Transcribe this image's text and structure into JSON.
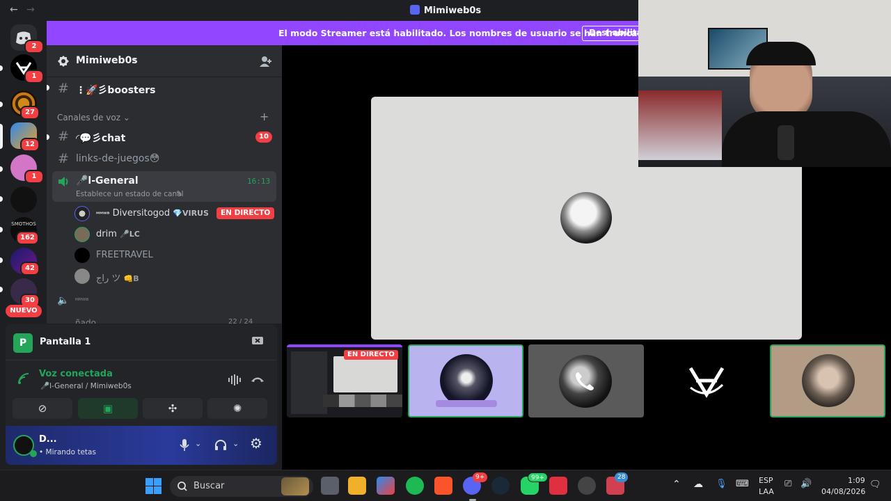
{
  "titlebar": {
    "title": "Mimiweb0s",
    "back_icon": "←",
    "forward_icon": "→"
  },
  "banner": {
    "message": "El modo Streamer está habilitado. Los nombres de usuario se han truncado.",
    "button": "Deshabilitar"
  },
  "guild_rail": {
    "home_badge": "2",
    "badges": [
      "1",
      "27",
      "12",
      "1",
      "162",
      "42",
      "30"
    ],
    "new_label": "NUEVO",
    "server_tile_text": "SMOTHOS"
  },
  "server": {
    "name": "Mimiweb0s",
    "chevron": "⌄"
  },
  "channels": {
    "boosters": "⋮🚀彡boosters",
    "voice_category": "Canales de voz",
    "chat": "◜💬彡chat",
    "chat_badge": "10",
    "games": "links-de-juegos😳",
    "general": "🎤l-General",
    "general_time": "16:13",
    "general_status": "Establece un estado de canal",
    "voice_users": [
      {
        "prefix": "ᴹᴹᵂᴮ",
        "name": "Diversitogod",
        "tag": "💎VIRUS",
        "live": "EN DIRECTO"
      },
      {
        "name": "drim",
        "tag": "🎤LC"
      },
      {
        "name": "FREETRAVEL"
      },
      {
        "name": "راج ツ",
        "tag": "👊B"
      }
    ],
    "next_voice": "ᴹᴹᵂᴮ",
    "partial": "ñado",
    "partial_count": "22 / 24"
  },
  "user_area": {
    "screen_title": "Pantalla 1",
    "voice_status": "Voz conectada",
    "voice_location": "🎤l-General / Mimiweb0s",
    "username": "D...",
    "activity": "• Mirando tetas"
  },
  "stage": {
    "live_label": "EN DIRECTO"
  },
  "taskbar": {
    "search_label": "Buscar",
    "discord_badge": "9+",
    "whatsapp_badge": "99+",
    "store_badge": "28",
    "lang_top": "ESP",
    "lang_bottom": "LAA",
    "time": "1:09",
    "date": "04/08/2026"
  },
  "colors": {
    "banner": "#9146ff",
    "voice_green": "#23a55a",
    "live_red": "#f23f43",
    "blurple": "#5865f2"
  }
}
